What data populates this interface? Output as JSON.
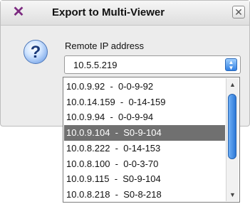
{
  "dialog": {
    "title": "Export to Multi-Viewer",
    "close_label": "✕",
    "app_icon_symbol": "✕",
    "question_icon_symbol": "?"
  },
  "field": {
    "label": "Remote IP address",
    "value": "10.5.5.219"
  },
  "dropdown": {
    "options": [
      {
        "label": "10.0.9.92  -  0-0-9-92"
      },
      {
        "label": "10.0.14.159  -  0-14-159"
      },
      {
        "label": "10.0.9.94  -  0-0-9-94"
      },
      {
        "label": "10.0.9.104  -  S0-9-104"
      },
      {
        "label": "10.0.8.222  -  0-14-153"
      },
      {
        "label": "10.0.8.100  -  0-0-3-70"
      },
      {
        "label": "10.0.9.115  -  S0-9-104"
      },
      {
        "label": "10.0.8.218  -  S0-8-218"
      }
    ],
    "selected_index": 3
  },
  "scrollbar": {
    "up_symbol": "▲",
    "down_symbol": "▼"
  }
}
